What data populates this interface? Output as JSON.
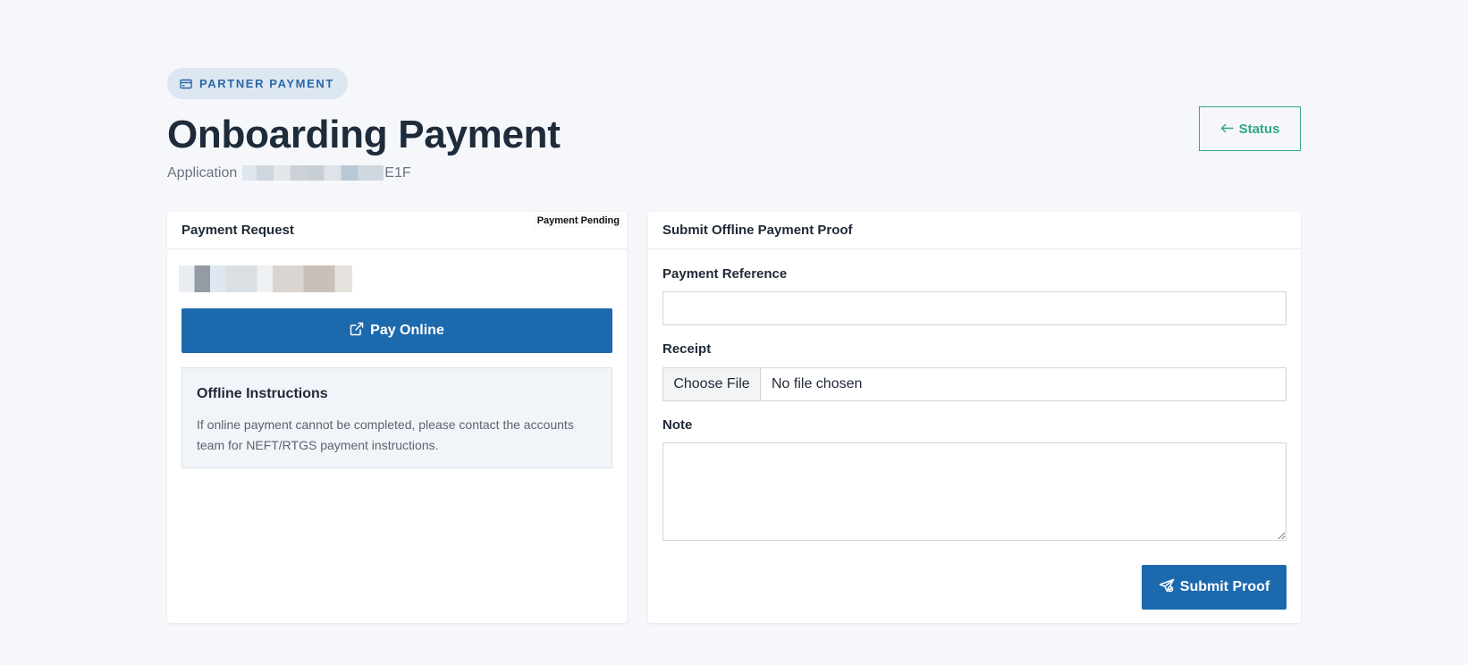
{
  "header": {
    "pill_label": "PARTNER PAYMENT",
    "title": "Onboarding Payment",
    "application_prefix": "Application",
    "application_suffix": "E1F",
    "status_button": "Status"
  },
  "payment_request": {
    "heading": "Payment Request",
    "badge": "Payment Pending",
    "pay_online_label": "Pay Online",
    "offline_title": "Offline Instructions",
    "offline_text": "If online payment cannot be completed, please contact the accounts team for NEFT/RTGS payment instructions."
  },
  "offline_proof": {
    "heading": "Submit Offline Payment Proof",
    "reference_label": "Payment Reference",
    "reference_value": "",
    "receipt_label": "Receipt",
    "choose_file_label": "Choose File",
    "no_file_text": "No file chosen",
    "note_label": "Note",
    "note_value": "",
    "submit_label": "Submit Proof"
  },
  "colors": {
    "primary": "#1d69ae",
    "accent_green": "#2fa88a",
    "pill_bg": "#dde7f1",
    "page_bg": "#f5f7fa"
  },
  "icons": {
    "pill": "card-icon",
    "status": "arrow-left-icon",
    "pay_online": "external-link-icon",
    "submit": "send-icon"
  }
}
